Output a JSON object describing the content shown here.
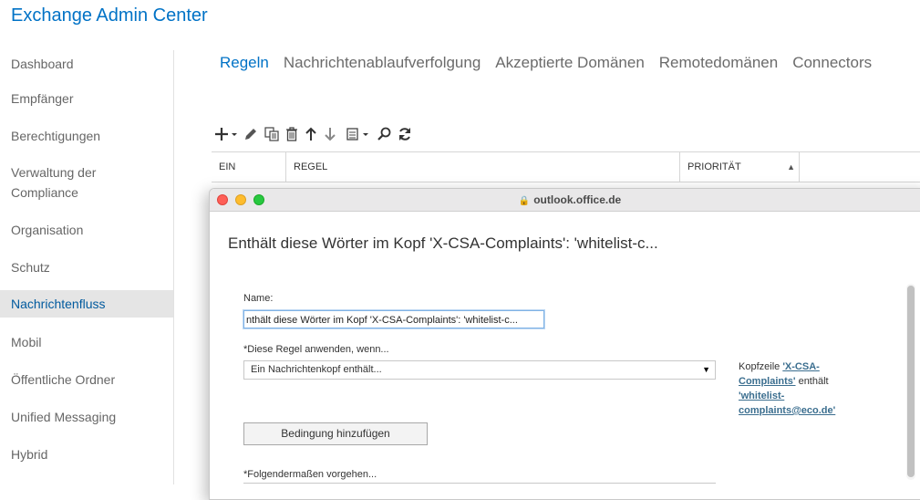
{
  "app": {
    "title": "Exchange Admin Center"
  },
  "sidebar": {
    "items": [
      {
        "label": "Dashboard"
      },
      {
        "label": "Empfänger"
      },
      {
        "label": "Berechtigungen"
      },
      {
        "label": "Verwaltung der Compliance"
      },
      {
        "label": "Organisation"
      },
      {
        "label": "Schutz"
      },
      {
        "label": "Nachrichtenfluss",
        "active": true
      },
      {
        "label": "Mobil"
      },
      {
        "label": "Öffentliche Ordner"
      },
      {
        "label": "Unified Messaging"
      },
      {
        "label": "Hybrid"
      }
    ]
  },
  "tabs": [
    {
      "label": "Regeln",
      "active": true
    },
    {
      "label": "Nachrichtenablaufverfolgung"
    },
    {
      "label": "Akzeptierte Domänen"
    },
    {
      "label": "Remotedomänen"
    },
    {
      "label": "Connectors"
    }
  ],
  "toolbar": {
    "icons": [
      "add-icon",
      "edit-icon",
      "copy-icon",
      "delete-icon",
      "move-up-icon",
      "move-down-icon",
      "report-icon",
      "search-icon",
      "refresh-icon"
    ]
  },
  "table": {
    "columns": [
      "EIN",
      "REGEL",
      "PRIORITÄT"
    ]
  },
  "popup": {
    "url": "outlook.office.de",
    "title": "Enthält diese Wörter im Kopf 'X-CSA-Complaints': 'whitelist-c...",
    "name_label": "Name:",
    "name_value": "nthält diese Wörter im Kopf 'X-CSA-Complaints': 'whitelist-c...",
    "condition_label": "*Diese Regel anwenden, wenn...",
    "condition_value": "Ein Nachrichtenkopf enthält...",
    "add_condition_label": "Bedingung hinzufügen",
    "action_label": "*Folgendermaßen vorgehen...",
    "desc": {
      "prefix": "Kopfzeile ",
      "header_link": "'X-CSA-Complaints'",
      "middle": " enthält ",
      "value_link": "'whitelist-complaints@eco.de'"
    }
  },
  "colors": {
    "accent": "#0072c6",
    "active_bg": "#e5e5e5"
  }
}
